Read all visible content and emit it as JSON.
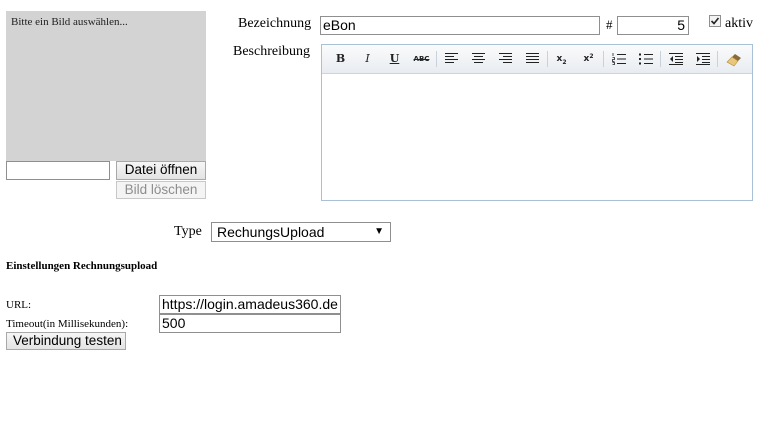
{
  "image_panel": {
    "placeholder_text": "Bitte ein Bild auswählen...",
    "file_path_value": "",
    "open_file_button": "Datei öffnen",
    "delete_image_button": "Bild löschen"
  },
  "form": {
    "name_label": "Bezeichnung",
    "name_value": "eBon",
    "number_label": "#",
    "number_value": "5",
    "active_label": "aktiv",
    "active_checked": true,
    "description_label": "Beschreibung",
    "description_value": ""
  },
  "editor_toolbar": {
    "buttons": [
      {
        "label": "B",
        "icon": "bold-icon"
      },
      {
        "label": "I",
        "icon": "italic-icon"
      },
      {
        "label": "U",
        "icon": "underline-icon"
      },
      {
        "label": "ABC",
        "icon": "strikethrough-icon"
      },
      {
        "icon": "align-left-icon"
      },
      {
        "icon": "align-center-icon"
      },
      {
        "icon": "align-right-icon"
      },
      {
        "icon": "align-justify-icon"
      },
      {
        "label": "x2",
        "icon": "subscript-icon"
      },
      {
        "label": "x2",
        "icon": "superscript-icon"
      },
      {
        "icon": "ordered-list-icon"
      },
      {
        "icon": "unordered-list-icon"
      },
      {
        "icon": "outdent-icon"
      },
      {
        "icon": "indent-icon"
      },
      {
        "icon": "clear-format-brush-icon"
      }
    ]
  },
  "type": {
    "label": "Type",
    "selected": "RechungsUpload"
  },
  "settings": {
    "heading": "Einstellungen Rechnungsupload",
    "url_label": "URL:",
    "url_value": "https://login.amadeus360.de",
    "timeout_label": "Timeout(in Millisekunden):",
    "timeout_value": "500",
    "test_button": "Verbindung testen"
  },
  "colors": {
    "image_placeholder_bg": "#d3d3d3",
    "editor_border": "#a9c1d6",
    "toolbar_bg": "#eef1f5"
  }
}
